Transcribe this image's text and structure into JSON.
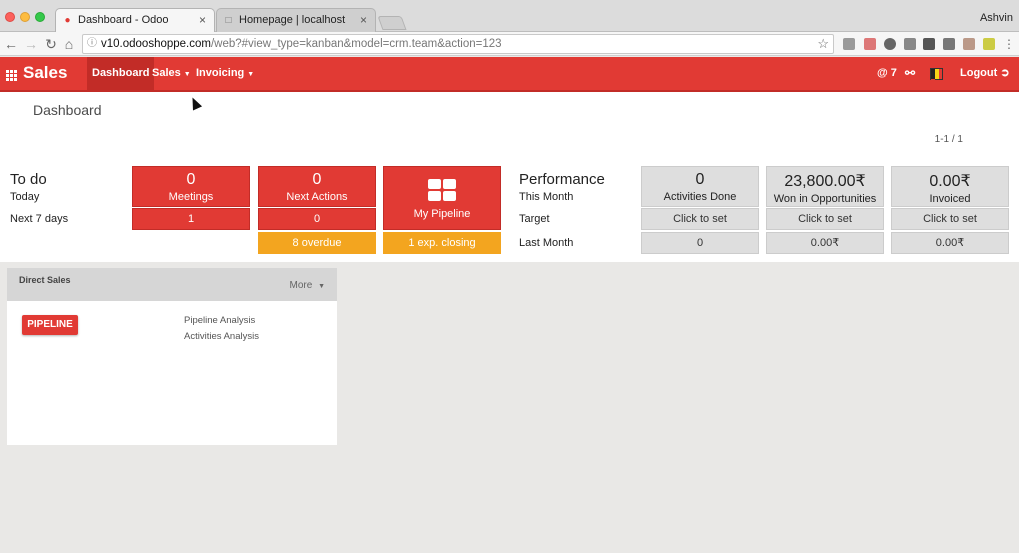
{
  "browser": {
    "tabs": [
      {
        "title": "Dashboard - Odoo",
        "active": true
      },
      {
        "title": "Homepage | localhost",
        "active": false
      }
    ],
    "user": "Ashvin",
    "url_host": "v10.odooshoppe.com",
    "url_path": "/web?#view_type=kanban&model=crm.team&action=123"
  },
  "topmenu": {
    "app": "Sales",
    "items": [
      "Dashboard",
      "Sales",
      "Invoicing"
    ],
    "mentions": "@ 7",
    "logout": "Logout",
    "color": "#e13a34"
  },
  "control": {
    "breadcrumb": "Dashboard",
    "pager": "1-1 / 1"
  },
  "todo": {
    "title": "To do",
    "today": "Today",
    "next7": "Next 7 days",
    "meetings": {
      "value": "0",
      "label": "Meetings",
      "next": "1"
    },
    "next_actions": {
      "value": "0",
      "label": "Next Actions",
      "next": "0",
      "overdue": "8 overdue"
    },
    "pipeline": {
      "label": "My Pipeline",
      "closing": "1 exp. closing"
    }
  },
  "performance": {
    "title": "Performance",
    "this_month": "This Month",
    "target": "Target",
    "last_month": "Last Month",
    "activities": {
      "value": "0",
      "label": "Activities Done",
      "target": "Click to set",
      "last": "0"
    },
    "won": {
      "value": "23,800.00₹",
      "label": "Won in Opportunities",
      "target": "Click to set",
      "last": "0.00₹"
    },
    "invoiced": {
      "value": "0.00₹",
      "label": "Invoiced",
      "target": "Click to set",
      "last": "0.00₹"
    }
  },
  "card": {
    "title": "Direct Sales",
    "more": "More",
    "pipeline_button": "PIPELINE",
    "links": [
      "Pipeline Analysis",
      "Activities Analysis"
    ]
  }
}
